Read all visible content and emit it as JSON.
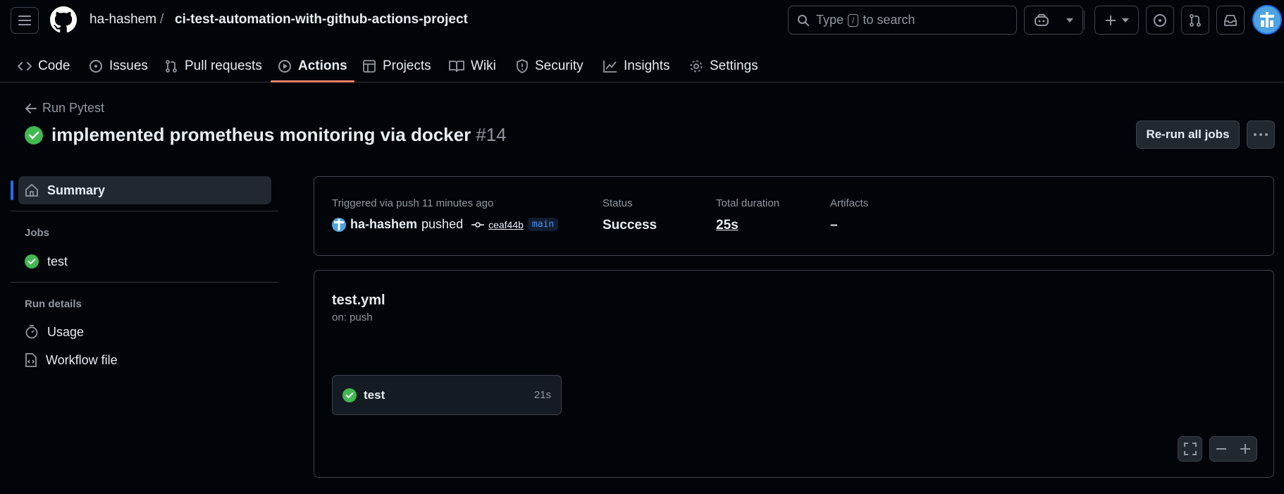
{
  "header": {
    "owner": "ha-hashem",
    "separator": "/",
    "repo": "ci-test-automation-with-github-actions-project",
    "search_prefix": "Type",
    "search_key": "/",
    "search_suffix": "to search"
  },
  "tabs": [
    {
      "label": "Code",
      "icon": "code-icon"
    },
    {
      "label": "Issues",
      "icon": "issue-icon"
    },
    {
      "label": "Pull requests",
      "icon": "pull-request-icon"
    },
    {
      "label": "Actions",
      "icon": "play-icon",
      "active": true
    },
    {
      "label": "Projects",
      "icon": "table-icon"
    },
    {
      "label": "Wiki",
      "icon": "book-icon"
    },
    {
      "label": "Security",
      "icon": "shield-icon"
    },
    {
      "label": "Insights",
      "icon": "graph-icon"
    },
    {
      "label": "Settings",
      "icon": "gear-icon"
    }
  ],
  "run": {
    "back_label": "Run Pytest",
    "title": "implemented prometheus monitoring via docker",
    "number": "#14",
    "rerun_label": "Re-run all jobs"
  },
  "sidebar": {
    "summary_label": "Summary",
    "jobs_heading": "Jobs",
    "job_label": "test",
    "run_details_heading": "Run details",
    "usage_label": "Usage",
    "workflow_file_label": "Workflow file"
  },
  "summary": {
    "trigger_label": "Triggered via push 11 minutes ago",
    "actor": "ha-hashem",
    "action": "pushed",
    "commit": "ceaf44b",
    "branch": "main",
    "status_label": "Status",
    "status_value": "Success",
    "duration_label": "Total duration",
    "duration_value": "25s",
    "artifacts_label": "Artifacts",
    "artifacts_value": "–"
  },
  "workflow": {
    "file": "test.yml",
    "trigger": "on: push",
    "job_name": "test",
    "job_duration": "21s"
  },
  "colors": {
    "success": "#3fb950",
    "accent": "#f78166",
    "link": "#4493f8"
  }
}
